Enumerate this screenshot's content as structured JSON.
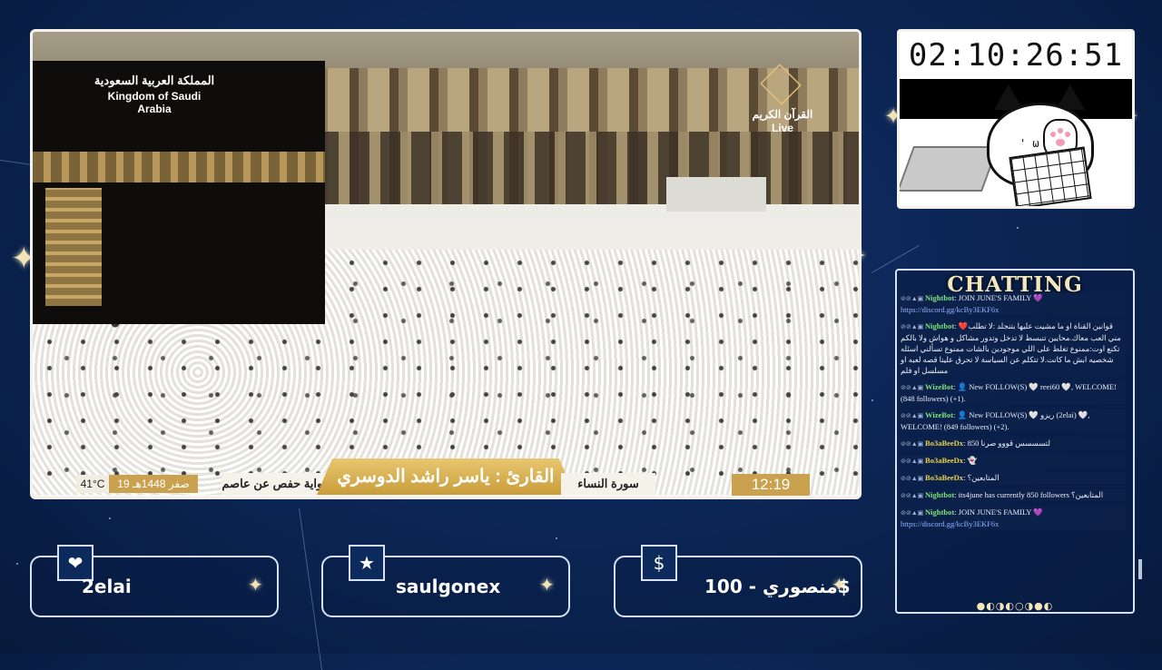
{
  "video": {
    "ksa_ar": "المملكة العربية السعودية",
    "ksa_en": "Kingdom of Saudi Arabia",
    "channel_ar": "القرآن الكريم",
    "channel_live": "Live",
    "temperature": "41°C",
    "hijri_date": "19 صفر 1448هـ",
    "riwaya": "رواية حفص عن عاصم",
    "reciter": "القارئ : ياسر راشد الدوسري",
    "surah": "سورة النساء",
    "time": "12:19"
  },
  "timer": {
    "value": "02:10:26:51"
  },
  "chat": {
    "title": "CHATTING",
    "messages": [
      {
        "user": "Nightbot",
        "user_color": "#7ee07e",
        "text": ": JOIN JUNE'S FAMILY 💜",
        "link": "https://discord.gg/kcBy3EKF6x"
      },
      {
        "user": "Nightbot",
        "user_color": "#7ee07e",
        "text": ": ❤️قوانين القناة او ما مشيت عليها بتنجلد :لا تطلب مني العب معاك.محايين تنبسط لا تدخل وتدور مشاكل و هواش ولا بالكم تكنع اوت:ممنوع تغلط على اللي موجودين بالشات ممنوع تسألني اسئله شخصيه ابش ما كانت.لا تتكلم عن السياسة لا تحرق علينا قصه لعبه او مسلسل او فلم",
        "link": ""
      },
      {
        "user": "WizeBot",
        "user_color": "#7ee07e",
        "text": ": 👤 New FOLLOW(S) 🤍 reei60 🤍, WELCOME! (848 followers) (+1).",
        "link": ""
      },
      {
        "user": "WizeBot",
        "user_color": "#7ee07e",
        "text": ": 👤 New FOLLOW(S) 🤍 ريزو (2elai) 🤍, WELCOME! (849 followers) (+2).",
        "link": ""
      },
      {
        "user": "Bo3aBeeDx",
        "user_color": "#e8d24a",
        "text": ": لتسسسس قووو صرنا 850",
        "link": ""
      },
      {
        "user": "Bo3aBeeDx",
        "user_color": "#e8d24a",
        "text": ": 👻",
        "link": ""
      },
      {
        "user": "Bo3aBeeDx",
        "user_color": "#e8d24a",
        "text": ": المتابعين؟",
        "link": ""
      },
      {
        "user": "Nightbot",
        "user_color": "#7ee07e",
        "text": ": its4june has currently 850 followers المتابعين؟",
        "link": ""
      },
      {
        "user": "Nightbot",
        "user_color": "#7ee07e",
        "text": ": JOIN JUNE'S FAMILY 💜",
        "link": "https://discord.gg/kcBy3EKF6x"
      }
    ],
    "dots": "●◐◑◐○◑●◐"
  },
  "alerts": [
    {
      "icon": "heart-icon",
      "glyph": "❤",
      "label": "2elai"
    },
    {
      "icon": "star-icon",
      "glyph": "★",
      "label": "saulgonex"
    },
    {
      "icon": "dollar-icon",
      "glyph": "$",
      "label": "منصوري - 100$"
    }
  ]
}
